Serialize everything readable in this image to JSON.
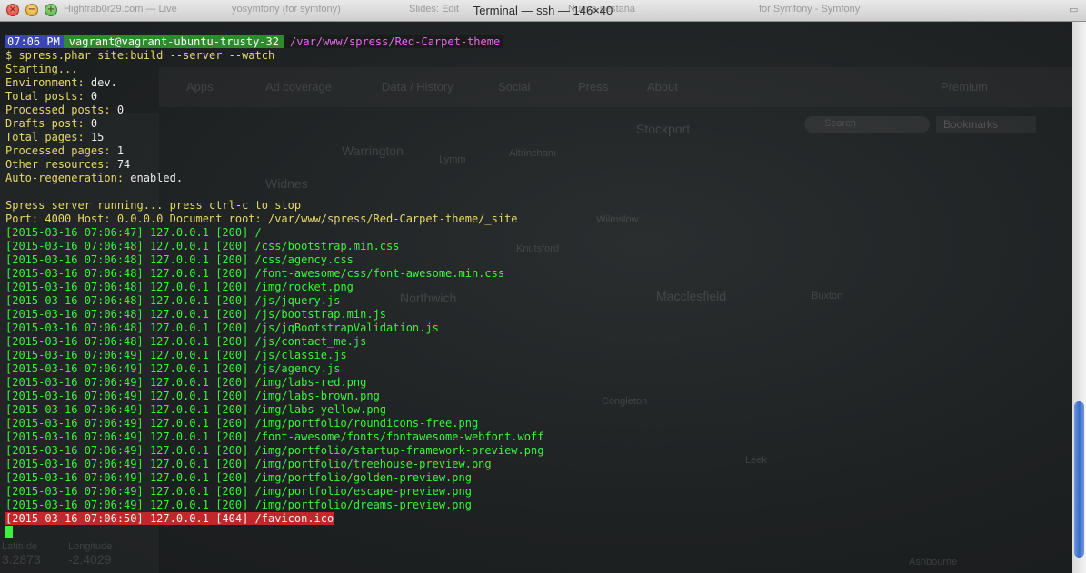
{
  "window": {
    "title": "Terminal — ssh — 146×40",
    "background_tabs": [
      "Highfrab0r29.com — Live",
      "yosymfony (for symfony)",
      "Slides: Edit",
      "Nueva pestaña",
      "for Symfony - Symfony"
    ]
  },
  "backdrop": {
    "nav_items": [
      "Apps",
      "Ad coverage",
      "Data / History",
      "Social",
      "Press",
      "About",
      "Premium"
    ],
    "search_placeholder": "Search",
    "bookmarks_label": "Bookmarks",
    "towns": [
      "Warrington",
      "Altrincham",
      "Stockport",
      "Northwich",
      "Macclesfield",
      "Buxton",
      "Widnes",
      "Lymm",
      "Wilmslow",
      "Knutsford",
      "Congleton",
      "Leek",
      "Ashbourne"
    ],
    "coord_labels": [
      "Latitude",
      "Longitude"
    ],
    "coord_values": [
      "3.2873",
      "-2.4029"
    ]
  },
  "terminal": {
    "prompt": {
      "time": "07:06 PM",
      "user_host": "vagrant@vagrant-ubuntu-trusty-32",
      "path": "/var/www/spress/Red-Carpet-theme"
    },
    "command": "$ spress.phar site:build --server --watch",
    "build_info": [
      {
        "label": "Starting...",
        "value": ""
      },
      {
        "label": "Environment: ",
        "value": "dev."
      },
      {
        "label": "Total posts: ",
        "value": "0"
      },
      {
        "label": "Processed posts: ",
        "value": "0"
      },
      {
        "label": "Drafts post: ",
        "value": "0"
      },
      {
        "label": "Total pages: ",
        "value": "15"
      },
      {
        "label": "Processed pages: ",
        "value": "1"
      },
      {
        "label": "Other resources: ",
        "value": "74"
      },
      {
        "label": "Auto-regeneration: ",
        "value": "enabled."
      }
    ],
    "server_msg": "Spress server running... press ctrl-c to stop",
    "server_info": "Port: 4000 Host: 0.0.0.0 Document root: /var/www/spress/Red-Carpet-theme/_site",
    "log": [
      "[2015-03-16 07:06:47] 127.0.0.1 [200] /",
      "[2015-03-16 07:06:48] 127.0.0.1 [200] /css/bootstrap.min.css",
      "[2015-03-16 07:06:48] 127.0.0.1 [200] /css/agency.css",
      "[2015-03-16 07:06:48] 127.0.0.1 [200] /font-awesome/css/font-awesome.min.css",
      "[2015-03-16 07:06:48] 127.0.0.1 [200] /img/rocket.png",
      "[2015-03-16 07:06:48] 127.0.0.1 [200] /js/jquery.js",
      "[2015-03-16 07:06:48] 127.0.0.1 [200] /js/bootstrap.min.js",
      "[2015-03-16 07:06:48] 127.0.0.1 [200] /js/jqBootstrapValidation.js",
      "[2015-03-16 07:06:48] 127.0.0.1 [200] /js/contact_me.js",
      "[2015-03-16 07:06:49] 127.0.0.1 [200] /js/classie.js",
      "[2015-03-16 07:06:49] 127.0.0.1 [200] /js/agency.js",
      "[2015-03-16 07:06:49] 127.0.0.1 [200] /img/labs-red.png",
      "[2015-03-16 07:06:49] 127.0.0.1 [200] /img/labs-brown.png",
      "[2015-03-16 07:06:49] 127.0.0.1 [200] /img/labs-yellow.png",
      "[2015-03-16 07:06:49] 127.0.0.1 [200] /img/portfolio/roundicons-free.png",
      "[2015-03-16 07:06:49] 127.0.0.1 [200] /font-awesome/fonts/fontawesome-webfont.woff",
      "[2015-03-16 07:06:49] 127.0.0.1 [200] /img/portfolio/startup-framework-preview.png",
      "[2015-03-16 07:06:49] 127.0.0.1 [200] /img/portfolio/treehouse-preview.png",
      "[2015-03-16 07:06:49] 127.0.0.1 [200] /img/portfolio/golden-preview.png",
      "[2015-03-16 07:06:49] 127.0.0.1 [200] /img/portfolio/escape-preview.png",
      "[2015-03-16 07:06:49] 127.0.0.1 [200] /img/portfolio/dreams-preview.png"
    ],
    "error_line": "[2015-03-16 07:06:50] 127.0.0.1 [404] /favicon.ico"
  },
  "colors": {
    "prompt_time_bg": "#3a45b8",
    "prompt_user_bg": "#2d8a2d",
    "prompt_path_fg": "#e36ee8",
    "label_yellow": "#e5d86a",
    "log_green": "#3cf23c",
    "error_bg": "#c2282b"
  }
}
